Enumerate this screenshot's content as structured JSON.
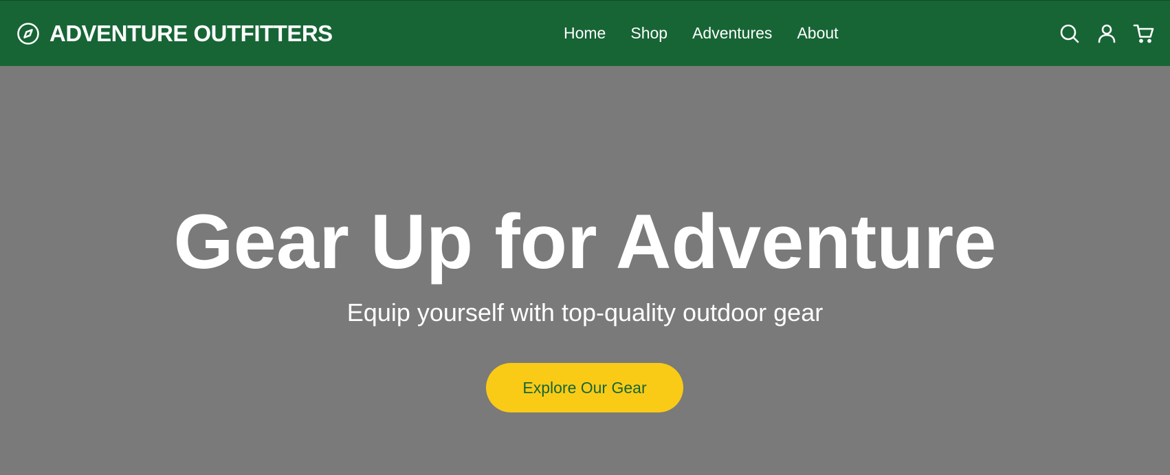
{
  "brand": {
    "name": "ADVENTURE OUTFITTERS",
    "icon": "compass-icon"
  },
  "nav": {
    "links": [
      {
        "label": "Home"
      },
      {
        "label": "Shop"
      },
      {
        "label": "Adventures"
      },
      {
        "label": "About"
      }
    ],
    "icons": [
      "search-icon",
      "user-icon",
      "cart-icon"
    ]
  },
  "hero": {
    "title": "Gear Up for Adventure",
    "subtitle": "Equip yourself with top-quality outdoor gear",
    "cta_label": "Explore Our Gear"
  },
  "colors": {
    "navbar_bg": "#176535",
    "hero_bg": "#7a7a7a",
    "cta_bg": "#f9cb17",
    "cta_text": "#176535",
    "text_light": "#ffffff"
  }
}
